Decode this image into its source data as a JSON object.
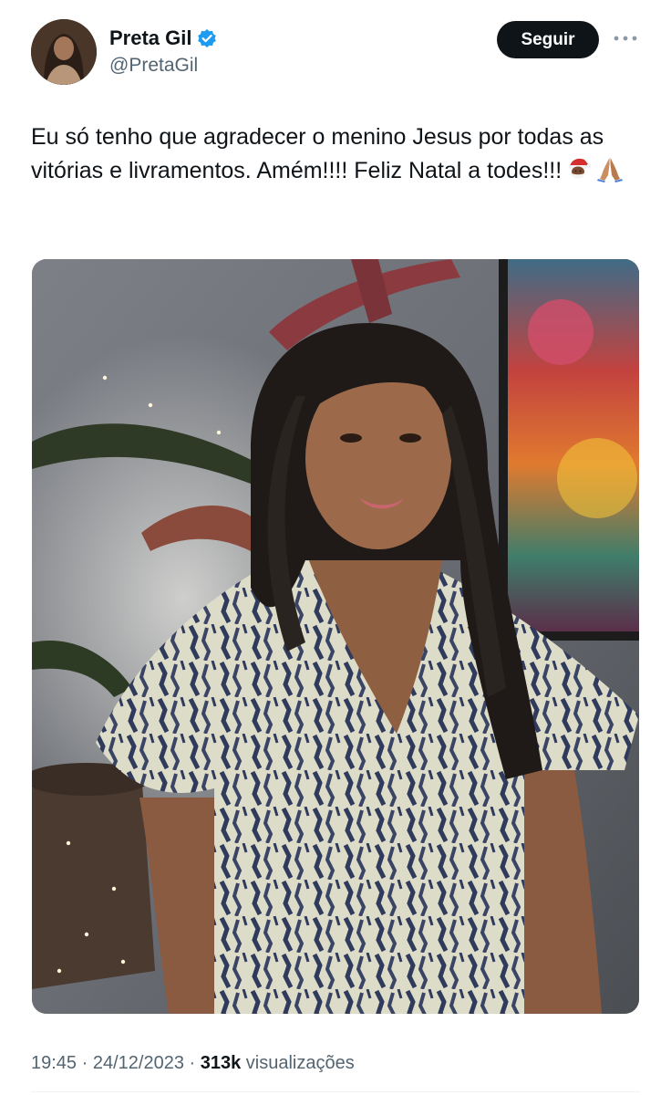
{
  "author": {
    "display_name": "Preta Gil",
    "handle": "@PretaGil",
    "verified": true,
    "avatar_icon": "avatar"
  },
  "actions": {
    "follow_label": "Seguir",
    "more_icon": "more-dots-icon"
  },
  "tweet": {
    "text": "Eu só tenho que agradecer o menino Jesus por todas as vitórias e livramentos. Amém!!!! Feliz Natal a todes!!!",
    "emojis": [
      "santa-claus-icon",
      "folded-hands-icon"
    ]
  },
  "media": {
    "kind": "photo"
  },
  "meta": {
    "time": "19:45",
    "sep1": " · ",
    "date": "24/12/2023",
    "sep2": " · ",
    "views_count": "313k",
    "views_label": " visualizações"
  },
  "colors": {
    "text": "#0f1419",
    "secondary": "#536471",
    "verified_blue": "#1d9bf0",
    "follow_bg": "#0f1419"
  }
}
